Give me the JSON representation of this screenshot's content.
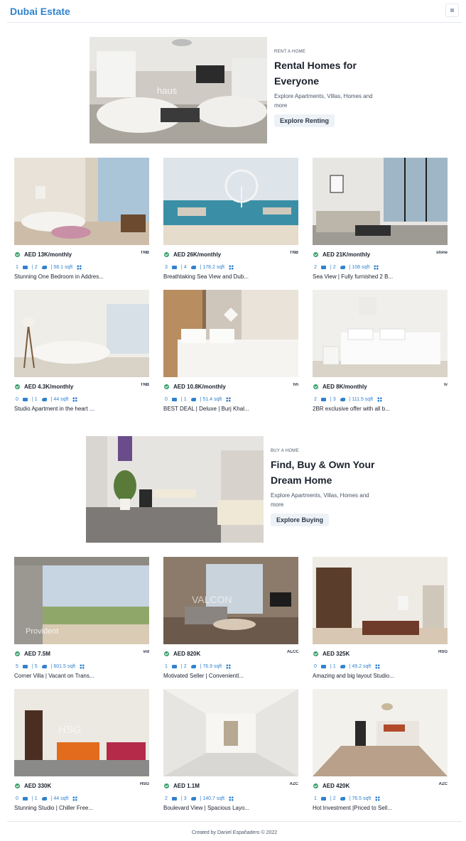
{
  "app": {
    "brand": "Dubai Estate"
  },
  "rent_banner": {
    "eyebrow": "RENT A HOME",
    "title": "Rental Homes for Everyone",
    "description": "Explore Apartments, Villas, Homes and more",
    "button": "Explore Renting"
  },
  "buy_banner": {
    "eyebrow": "BUY A HOME",
    "title": "Find, Buy & Own Your Dream Home",
    "description": "Explore Apartments, Villas, Homes and more",
    "button": "Explore Buying"
  },
  "rent_listings": [
    {
      "price": "AED 13K/monthly",
      "rooms": "1",
      "baths": "2",
      "area": "58.1 sqft",
      "title": "Stunning One Bedroom in Addres...",
      "agency": "TNB"
    },
    {
      "price": "AED 26K/monthly",
      "rooms": "3",
      "baths": "4",
      "area": "178.2 sqft",
      "title": "Breathtaking Sea View and Dub...",
      "agency": "TNB"
    },
    {
      "price": "AED 21K/monthly",
      "rooms": "2",
      "baths": "2",
      "area": "108 sqft",
      "title": "Sea View | Fully furnished 2 B...",
      "agency": "stonetree"
    },
    {
      "price": "AED 4.3K/monthly",
      "rooms": "0",
      "baths": "1",
      "area": "44 sqft",
      "title": "Studio Apartment in the heart ...",
      "agency": "TNB"
    },
    {
      "price": "AED 10.8K/monthly",
      "rooms": "0",
      "baths": "1",
      "area": "51.4 sqft",
      "title": "BEST DEAL | Deluxe | Burj Khal...",
      "agency": "hh"
    },
    {
      "price": "AED 8K/monthly",
      "rooms": "2",
      "baths": "3",
      "area": "111.5 sqft",
      "title": "2BR exclusive offer with all b...",
      "agency": "lv"
    }
  ],
  "buy_listings": [
    {
      "price": "AED 7.5M",
      "rooms": "5",
      "baths": "5",
      "area": "601.5 sqft",
      "title": "Corner Villa | Vacant on Trans...",
      "agency": "vid"
    },
    {
      "price": "AED 820K",
      "rooms": "1",
      "baths": "2",
      "area": "76.9 sqft",
      "title": "Motivated Seller | Convenientl...",
      "agency": "ALCO"
    },
    {
      "price": "AED 325K",
      "rooms": "0",
      "baths": "1",
      "area": "49.2 sqft",
      "title": "Amazing and big layout Studio...",
      "agency": "HSG"
    },
    {
      "price": "AED 330K",
      "rooms": "0",
      "baths": "1",
      "area": "44 sqft",
      "title": "Stunning Studio | Chiller Free...",
      "agency": "HSG"
    },
    {
      "price": "AED 1.1M",
      "rooms": "2",
      "baths": "3",
      "area": "140.7 sqft",
      "title": "Boulevard View | Spacious Layo...",
      "agency": "AZC"
    },
    {
      "price": "AED 420K",
      "rooms": "1",
      "baths": "2",
      "area": "76.5 sqft",
      "title": "Hot Investment |Priced to Sell...",
      "agency": "AZC"
    }
  ],
  "footer": {
    "text": "Created by Daniel Españadero © 2022"
  },
  "colors": {
    "brand": "#3182ce",
    "verified": "#38a169"
  }
}
